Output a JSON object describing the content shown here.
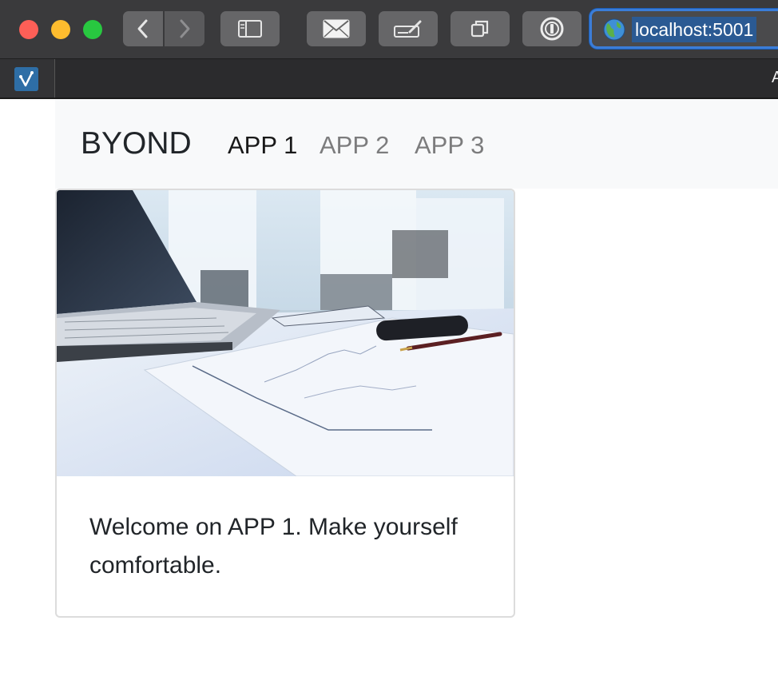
{
  "browser": {
    "url": "localhost:5001",
    "tab_edge_letter": "A",
    "toolbar_buttons": [
      "back-icon",
      "forward-icon",
      "sidebar-icon",
      "mail-icon",
      "compose-icon",
      "tabs-overview-icon",
      "onepassword-icon"
    ],
    "colors": {
      "chrome": "#3a3a3c",
      "address_highlight": "#2b5a93",
      "focus_ring": "#3b7dd8"
    }
  },
  "navbar": {
    "brand": "BYOND",
    "links": [
      {
        "label": "APP 1",
        "active": true
      },
      {
        "label": "APP 2",
        "active": false
      },
      {
        "label": "APP 3",
        "active": false
      }
    ]
  },
  "card": {
    "image_icon": "office-desk-laptop-photo",
    "text": "Welcome on APP 1. Make yourself comfortable."
  }
}
